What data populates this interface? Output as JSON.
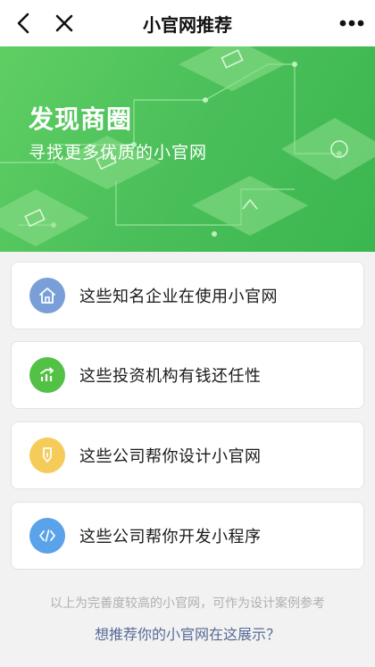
{
  "nav": {
    "title": "小官网推荐"
  },
  "banner": {
    "title": "发现商圈",
    "subtitle": "寻找更多优质的小官网"
  },
  "cards": [
    {
      "label": "这些知名企业在使用小官网",
      "icon": "home-icon",
      "color": "#7a9fd8"
    },
    {
      "label": "这些投资机构有钱还任性",
      "icon": "growth-chart-icon",
      "color": "#53c146"
    },
    {
      "label": "这些公司帮你设计小官网",
      "icon": "pen-icon",
      "color": "#f5cc5a"
    },
    {
      "label": "这些公司帮你开发小程序",
      "icon": "code-icon",
      "color": "#5aa2ea"
    }
  ],
  "footer": {
    "note": "以上为完善度较高的小官网，可作为设计案例参考",
    "link": "想推荐你的小官网在这展示？"
  },
  "colors": {
    "banner_green": "#4cc05a",
    "link_blue": "#576b95"
  }
}
